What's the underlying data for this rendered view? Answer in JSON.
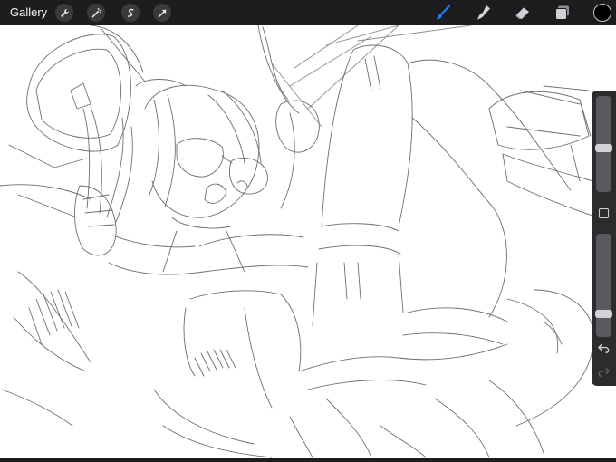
{
  "toolbar": {
    "gallery_label": "Gallery",
    "left_tools": [
      {
        "icon": "wrench-icon"
      },
      {
        "icon": "magic-wand-icon"
      },
      {
        "icon": "selection-icon"
      },
      {
        "icon": "transform-arrow-icon"
      }
    ],
    "right_tools": [
      {
        "icon": "brush-icon",
        "active": true
      },
      {
        "icon": "smudge-icon"
      },
      {
        "icon": "eraser-icon"
      },
      {
        "icon": "layers-icon"
      }
    ],
    "current_color": "#000000",
    "active_color": "#1e7cf2"
  },
  "sidebar": {
    "brush_size": 0.45,
    "opacity": 0.2,
    "icons": [
      "modify-icon",
      "undo-icon",
      "redo-icon"
    ]
  },
  "colors": {
    "bar": "#1d1d1f",
    "canvas": "#ffffff",
    "sketch_line": "#6e6e6e"
  }
}
